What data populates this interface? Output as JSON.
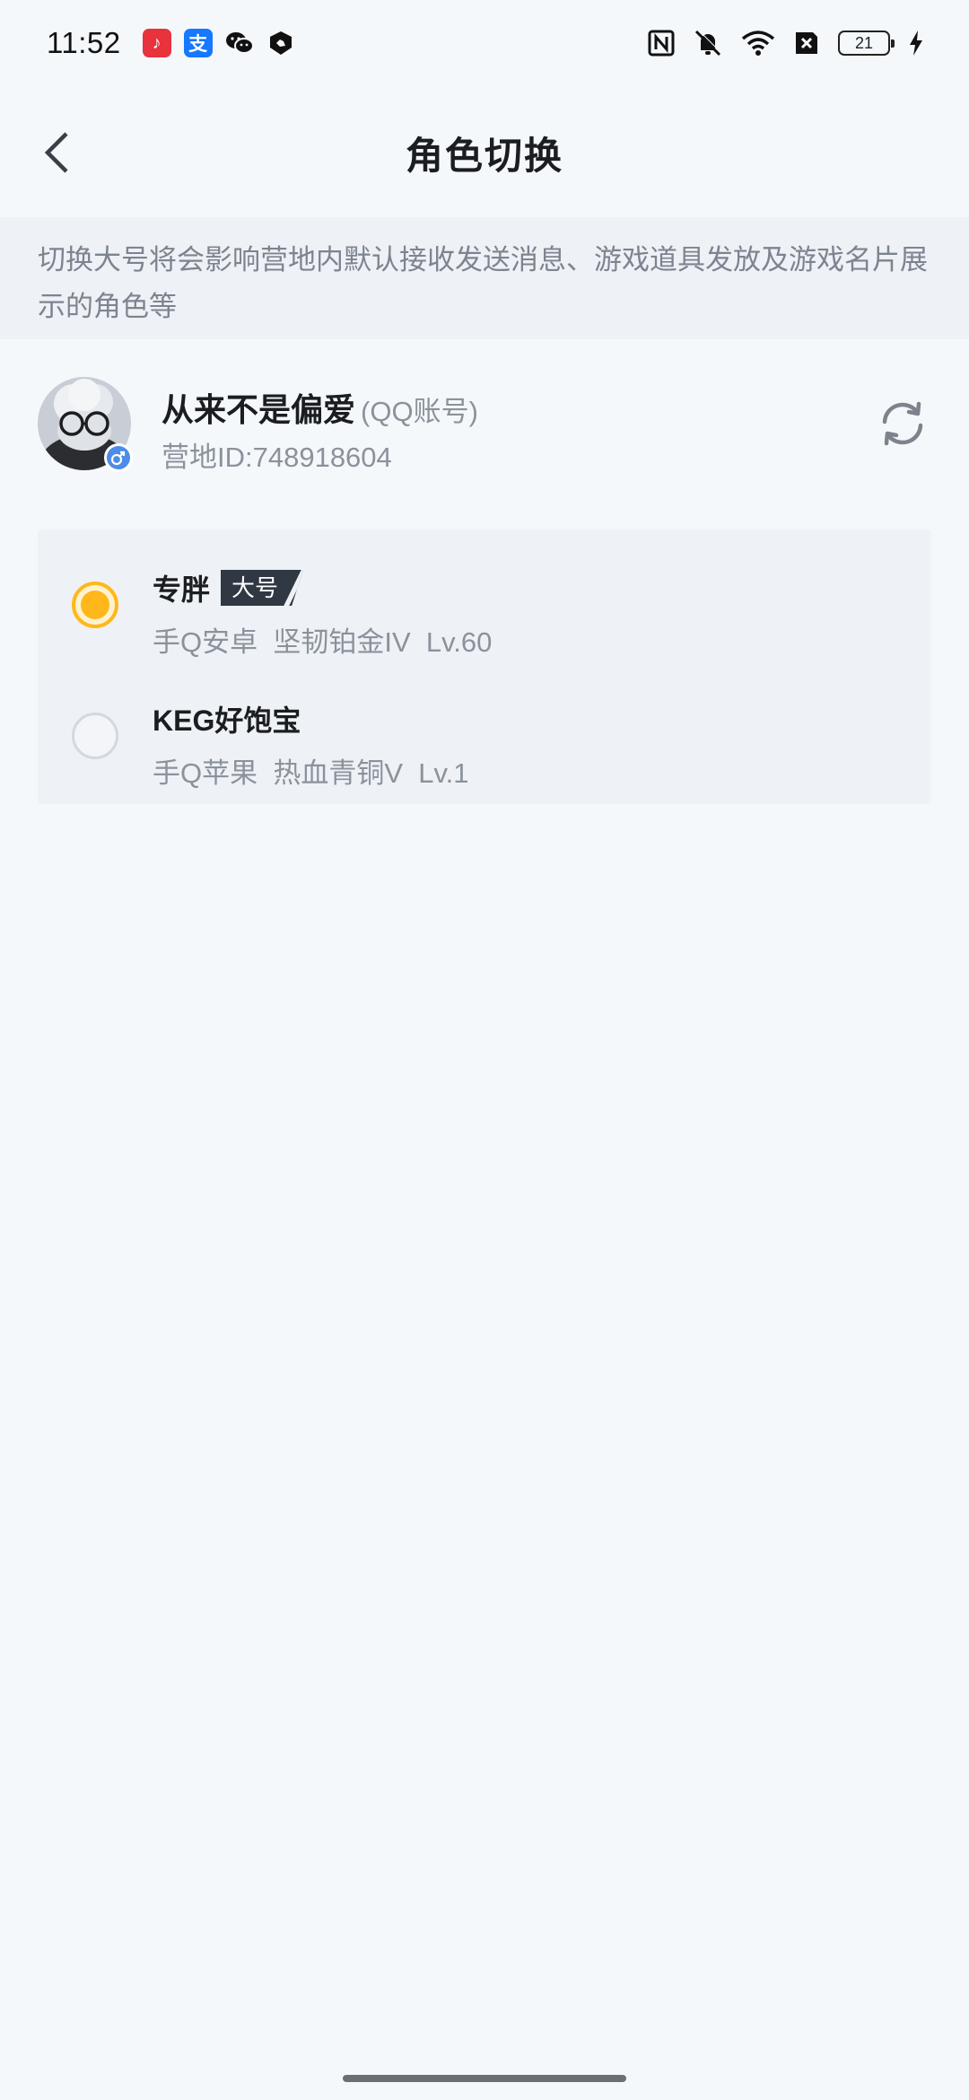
{
  "status_bar": {
    "time": "11:52",
    "notification_icons": [
      "music-app-icon",
      "alipay-icon",
      "wechat-icon",
      "game-app-icon"
    ],
    "system_icons": [
      "nfc-icon",
      "mute-icon",
      "wifi-icon",
      "sim-off-icon",
      "battery-icon"
    ],
    "battery_level": "21",
    "charging": true
  },
  "header": {
    "title": "角色切换",
    "back_icon": "chevron-left-icon"
  },
  "notice": {
    "text": "切换大号将会影响营地内默认接收发送消息、游戏道具发放及游戏名片展示的角色等"
  },
  "profile": {
    "name": "从来不是偏爱",
    "account_type": "(QQ账号)",
    "camp_id": "营地ID:748918604",
    "gender": "male",
    "refresh_icon": "refresh-icon"
  },
  "roles": [
    {
      "name": "专胖",
      "badge": "大号",
      "detail": "手Q安卓  坚韧铂金IV  Lv.60",
      "selected": true
    },
    {
      "name": "KEG好饱宝",
      "badge": "",
      "detail": "手Q苹果  热血青铜V  Lv.1",
      "selected": false
    }
  ],
  "colors": {
    "background": "#f5f8fb",
    "accent": "#ffb71b",
    "badge_bg": "#2f3843",
    "secondary_text": "#8b929c",
    "gender_badge": "#4d8ce8"
  }
}
